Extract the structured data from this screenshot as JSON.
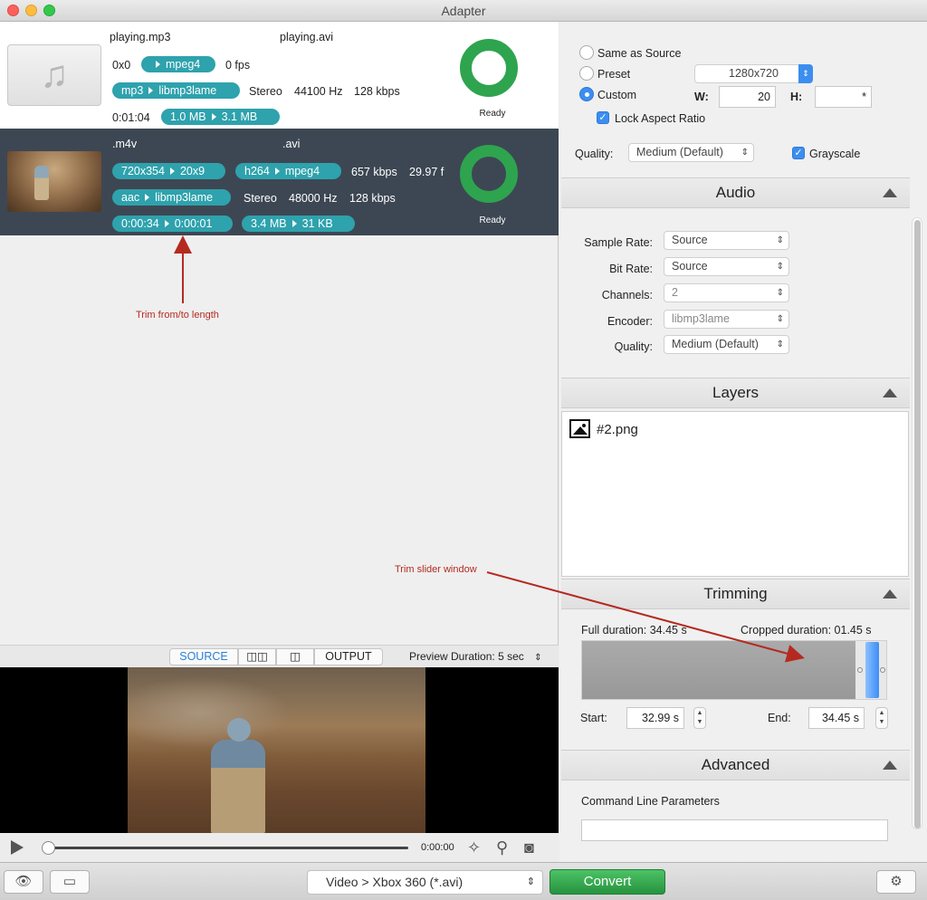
{
  "window": {
    "title": "Adapter"
  },
  "files": [
    {
      "input_name": "playing.mp3",
      "output_name": "playing.avi",
      "resolution": "0x0",
      "video_codec": {
        "from": "",
        "to": "mpeg4"
      },
      "fps": "0 fps",
      "audio_codec": {
        "from": "mp3",
        "to": "libmp3lame"
      },
      "channels": "Stereo",
      "sample_rate": "44100 Hz",
      "audio_bitrate": "128 kbps",
      "duration": "0:01:04",
      "size": {
        "from": "1.0 MB",
        "to": "3.1 MB"
      },
      "status": "Ready"
    },
    {
      "input_name": ".m4v",
      "output_name": ".avi",
      "resolution": {
        "from": "720x354",
        "to": "20x9"
      },
      "video_codec": {
        "from": "h264",
        "to": "mpeg4"
      },
      "video_bitrate": "657 kbps",
      "fps": "29.97 f",
      "audio_codec": {
        "from": "aac",
        "to": "libmp3lame"
      },
      "channels": "Stereo",
      "sample_rate": "48000 Hz",
      "audio_bitrate": "128 kbps",
      "trim": {
        "from": "0:00:34",
        "to": "0:00:01"
      },
      "size": {
        "from": "3.4 MB",
        "to": "31 KB"
      },
      "status": "Ready"
    }
  ],
  "annotations": {
    "trim_length": "Trim from/to  length",
    "trim_slider": "Trim slider window"
  },
  "preview": {
    "tabs": [
      "SOURCE",
      "",
      "",
      "OUTPUT"
    ],
    "active_tab": "SOURCE",
    "duration_label": "Preview Duration:",
    "duration_value": "5 sec",
    "timecode": "0:00:00",
    "playhead_fraction": 0
  },
  "video_settings": {
    "size_options": [
      "Same as Source",
      "Preset",
      "Custom"
    ],
    "selected_size": "Custom",
    "preset_value": "1280x720",
    "width_label": "W:",
    "width_value": "20",
    "height_label": "H:",
    "height_value": "*",
    "lock_aspect_label": "Lock Aspect Ratio",
    "lock_aspect_checked": true,
    "quality_label": "Quality:",
    "quality_value": "Medium (Default)",
    "grayscale_label": "Grayscale",
    "grayscale_checked": true
  },
  "audio": {
    "header": "Audio",
    "sample_rate_label": "Sample Rate:",
    "sample_rate_value": "Source",
    "bit_rate_label": "Bit Rate:",
    "bit_rate_value": "Source",
    "channels_label": "Channels:",
    "channels_value": "2",
    "encoder_label": "Encoder:",
    "encoder_value": "libmp3lame",
    "quality_label": "Quality:",
    "quality_value": "Medium (Default)"
  },
  "layers": {
    "header": "Layers",
    "items": [
      "#2.png"
    ]
  },
  "trimming": {
    "header": "Trimming",
    "full_duration": "Full duration: 34.45 s",
    "cropped_duration": "Cropped duration: 01.45 s",
    "start_label": "Start:",
    "start_value": "32.99 s",
    "end_label": "End:",
    "end_value": "34.45 s"
  },
  "advanced": {
    "header": "Advanced",
    "command_line_label": "Command Line Parameters",
    "command_line_value": ""
  },
  "toolbar": {
    "preset_select": "Video > Xbox 360 (*.avi)",
    "convert_label": "Convert"
  },
  "icons": [
    "eye-icon",
    "terminal-icon",
    "gear-icon",
    "play-icon",
    "magic-wand-icon",
    "zoom-icon",
    "camera-icon",
    "music-note-icon",
    "image-icon"
  ],
  "colors": {
    "pill": "#2ea2ad",
    "ring": "#2ea44f",
    "convert": "#34a853",
    "accent": "#3b8ef0",
    "annotation": "#b52a20"
  }
}
